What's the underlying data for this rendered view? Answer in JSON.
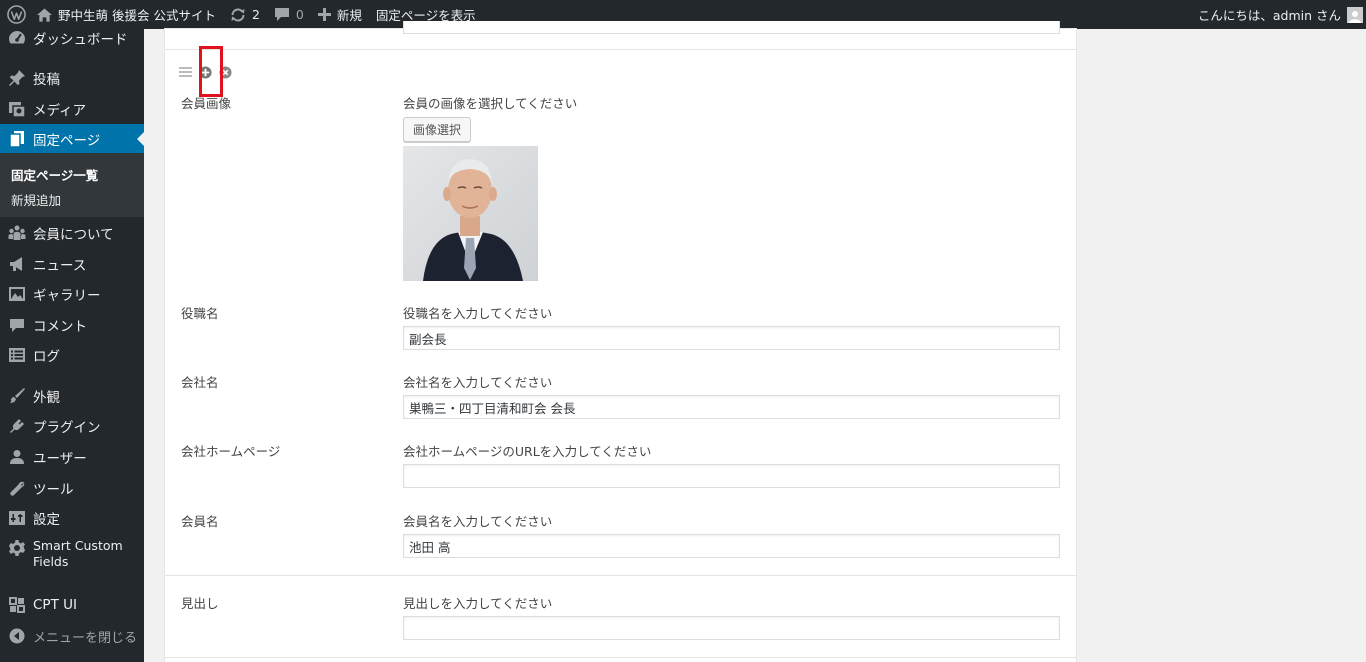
{
  "adminbar": {
    "site_name": "野中生萌 後援会 公式サイト",
    "updates_count": "2",
    "comments_count": "0",
    "new_label": "新規",
    "view_page_label": "固定ページを表示",
    "greeting": "こんにちは、admin さん"
  },
  "sidebar": {
    "dashboard": "ダッシュボード",
    "posts": "投稿",
    "media": "メディア",
    "pages": "固定ページ",
    "pages_submenu": [
      "固定ページ一覧",
      "新規追加"
    ],
    "members": "会員について",
    "news": "ニュース",
    "gallery": "ギャラリー",
    "comments": "コメント",
    "log": "ログ",
    "appearance": "外観",
    "plugins": "プラグイン",
    "users": "ユーザー",
    "tools": "ツール",
    "settings": "設定",
    "scf": "Smart Custom Fields",
    "cptui": "CPT UI",
    "collapse": "メニューを閉じる"
  },
  "fields": {
    "member_image": {
      "label": "会員画像",
      "instruction": "会員の画像を選択してください",
      "button": "画像選択"
    },
    "position": {
      "label": "役職名",
      "instruction": "役職名を入力してください",
      "value": "副会長"
    },
    "company": {
      "label": "会社名",
      "instruction": "会社名を入力してください",
      "value": "巣鴨三・四丁目清和町会 会長"
    },
    "homepage": {
      "label": "会社ホームページ",
      "instruction": "会社ホームページのURLを入力してください",
      "value": ""
    },
    "member_name": {
      "label": "会員名",
      "instruction": "会員名を入力してください",
      "value": "池田 高"
    },
    "heading": {
      "label": "見出し",
      "instruction": "見出しを入力してください",
      "value": ""
    }
  },
  "colors": {
    "adminbar_bg": "#23282d",
    "accent": "#0073aa",
    "highlight": "#e0121d"
  }
}
